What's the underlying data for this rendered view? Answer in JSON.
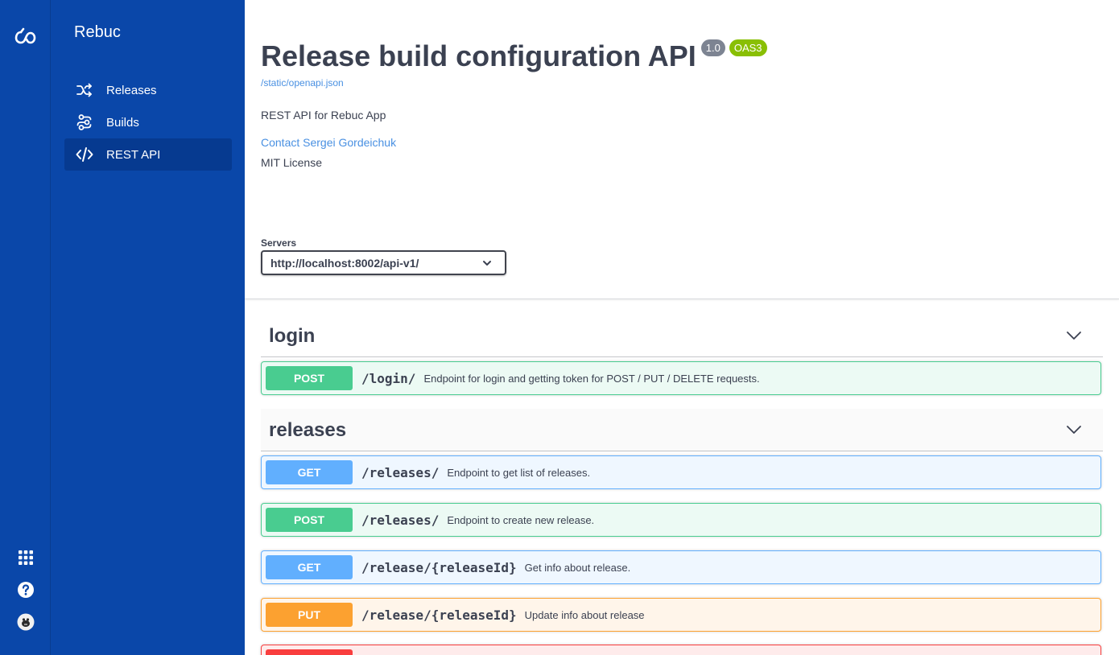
{
  "sidebar": {
    "app_name": "Rebuc",
    "items": [
      {
        "label": "Releases",
        "icon": "shuffle-icon"
      },
      {
        "label": "Builds",
        "icon": "builds-icon"
      },
      {
        "label": "REST API",
        "icon": "code-icon",
        "active": true
      }
    ]
  },
  "rail": {
    "icons": [
      "rebuc-logo-icon",
      "apps-grid-icon",
      "help-icon",
      "avatar"
    ]
  },
  "api": {
    "title": "Release build configuration API",
    "version": "1.0",
    "oas_badge": "OAS3",
    "spec_url": "/static/openapi.json",
    "description": "REST API for Rebuc App",
    "contact": "Contact Sergei Gordeichuk",
    "license": "MIT License"
  },
  "servers": {
    "label": "Servers",
    "selected": "http://localhost:8002/api-v1/"
  },
  "tags": [
    {
      "name": "login",
      "operations": [
        {
          "method": "POST",
          "path": "/login/",
          "summary": "Endpoint for login and getting token for POST / PUT / DELETE requests."
        }
      ]
    },
    {
      "name": "releases",
      "operations": [
        {
          "method": "GET",
          "path": "/releases/",
          "summary": "Endpoint to get list of releases."
        },
        {
          "method": "POST",
          "path": "/releases/",
          "summary": "Endpoint to create new release."
        },
        {
          "method": "GET",
          "path": "/release/{releaseId}",
          "summary": "Get info about release."
        },
        {
          "method": "PUT",
          "path": "/release/{releaseId}",
          "summary": "Update info about release"
        },
        {
          "method": "",
          "path": "",
          "summary": ""
        }
      ]
    }
  ],
  "colors": {
    "sidebar_bg": "#0a47a9",
    "active_item_bg": "#063a90",
    "post": "#49cc90",
    "get": "#61affe",
    "put": "#fca130",
    "delete": "#f93e3e",
    "link": "#4990e2",
    "oas_badge": "#89bf04",
    "version_badge": "#7d8492"
  }
}
